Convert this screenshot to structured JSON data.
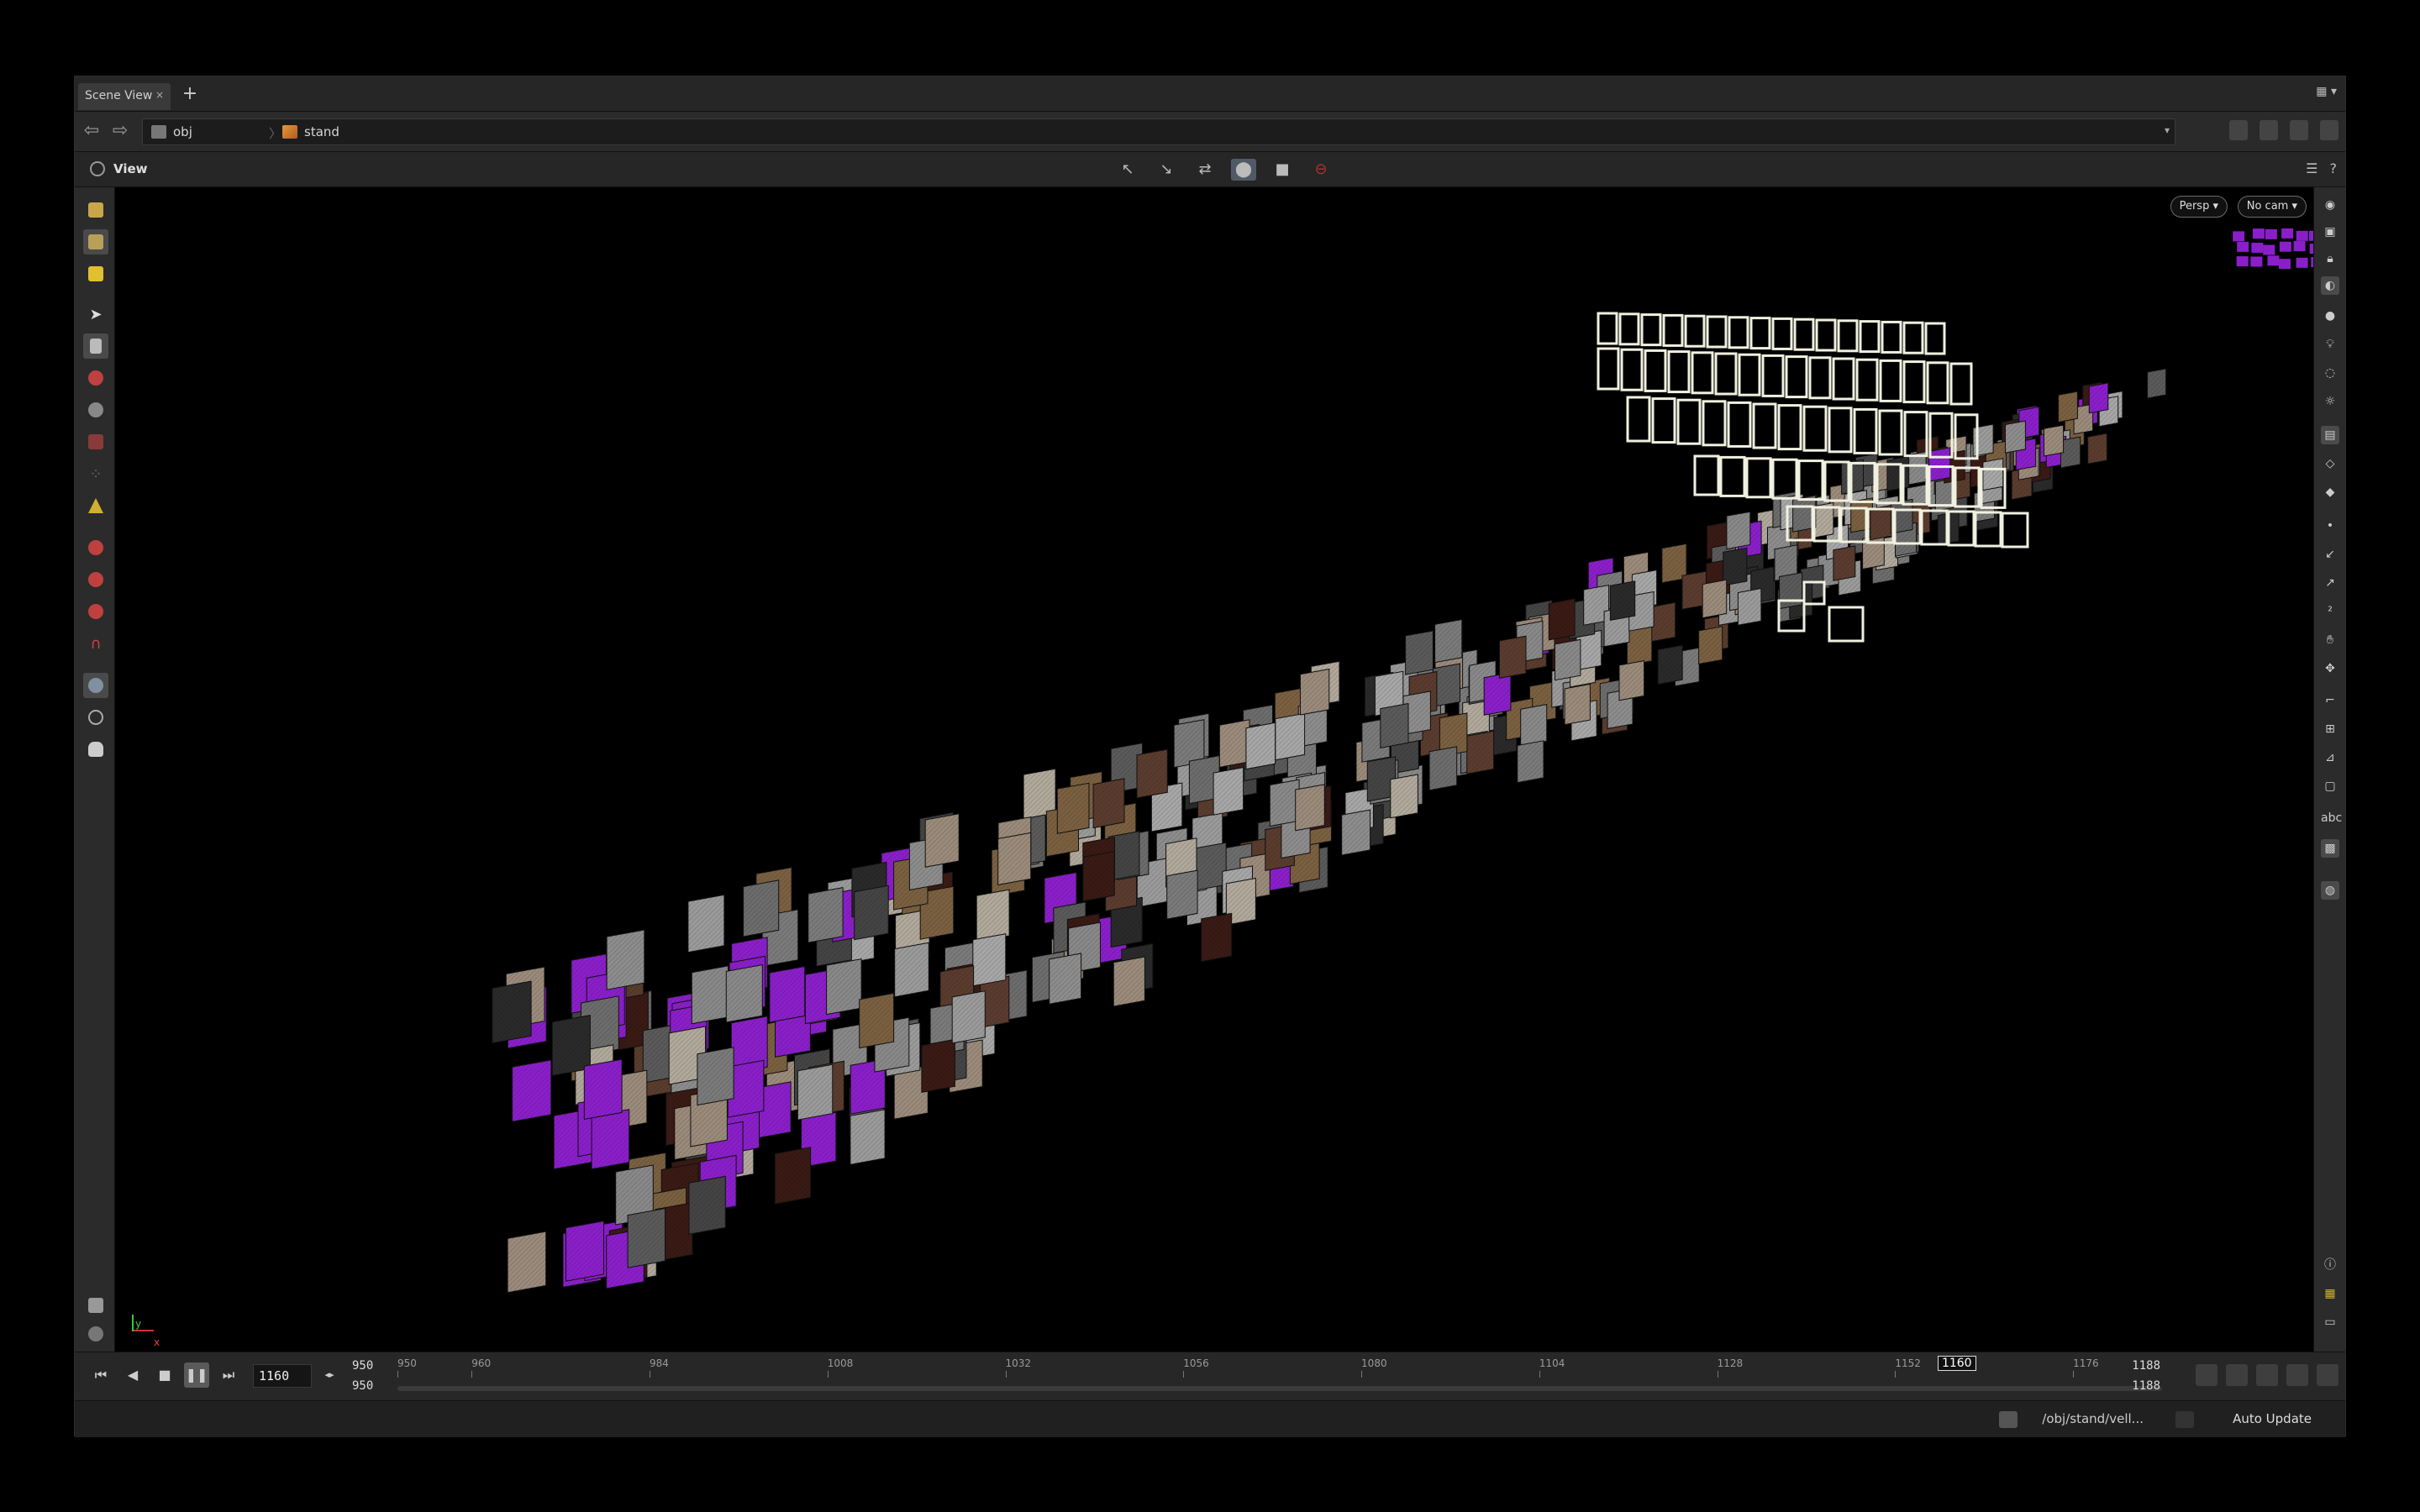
{
  "tabs": [
    {
      "label": "Scene View",
      "close": "×"
    }
  ],
  "tab_add": "+",
  "path": {
    "crumbs": [
      "obj",
      "stand"
    ]
  },
  "view": {
    "label": "View"
  },
  "camera": {
    "persp": "Persp",
    "cam": "No cam"
  },
  "timeline": {
    "current_frame": "1160",
    "range_start_top": "950",
    "range_start_bottom": "950",
    "range_end_top": "1188",
    "range_end_bottom": "1188",
    "ticks": [
      "950",
      "960",
      "984",
      "1008",
      "1032",
      "1056",
      "1080",
      "1104",
      "1128",
      "1152",
      "1176"
    ],
    "cursor_label": "1160"
  },
  "status": {
    "node_path": "/obj/stand/vell...",
    "update_mode": "Auto Update"
  },
  "axes": {
    "x": "x",
    "y": "y"
  },
  "colors": {
    "accent_purple": "#8a1fc9",
    "playback_active": "#5a5a5a"
  }
}
